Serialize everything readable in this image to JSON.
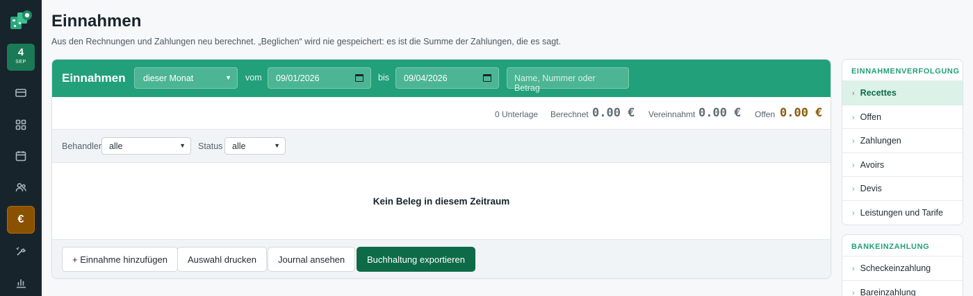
{
  "rail": {
    "date_day": "4",
    "date_month": "SEP",
    "active_symbol": "€",
    "icons": [
      "card-icon",
      "grid-icon",
      "calendar-icon",
      "users-icon",
      "euro-icon",
      "tools-icon",
      "bar-chart-icon"
    ]
  },
  "page": {
    "title": "Einnahmen",
    "subtitle": "Aus den Rechnungen und Zahlungen neu berechnet. „Beglichen“ wird nie gespeichert: es ist die Summe der Zahlungen, die es sagt."
  },
  "card": {
    "title": "Einnahmen",
    "period": "dieser Monat",
    "from_label": "vom",
    "from_date": "09/01/2026",
    "to_label": "bis",
    "to_date": "09/04/2026",
    "search_placeholder": "Name, Nummer oder Betrag"
  },
  "stats": {
    "count": "0 Unterlage",
    "billed_label": "Berechnet",
    "billed_value": "0.00 €",
    "collected_label": "Vereinnahmt",
    "collected_value": "0.00 €",
    "open_label": "Offen",
    "open_value": "0.00 €"
  },
  "filters": {
    "practitioner_label": "Behandler",
    "practitioner_value": "alle",
    "status_label": "Status",
    "status_value": "alle"
  },
  "empty_message": "Kein Beleg in diesem Zeitraum",
  "actions": {
    "add": "+ Einnahme hinzufügen",
    "print": "Auswahl drucken",
    "journal": "Journal ansehen",
    "export": "Buchhaltung exportieren"
  },
  "panel_income": {
    "heading": "EINNAHMENVERFOLGUNG",
    "items": [
      "Recettes",
      "Offen",
      "Zahlungen",
      "Avoirs",
      "Devis",
      "Leistungen und Tarife"
    ]
  },
  "panel_bank": {
    "heading": "BANKEINZAHLUNG",
    "items": [
      "Scheckeinzahlung",
      "Bareinzahlung"
    ]
  },
  "colors": {
    "brand_green": "#22a07a",
    "dark_green": "#0d6b48",
    "rail_bg": "#17242c",
    "accent_amber": "#8a5200"
  }
}
